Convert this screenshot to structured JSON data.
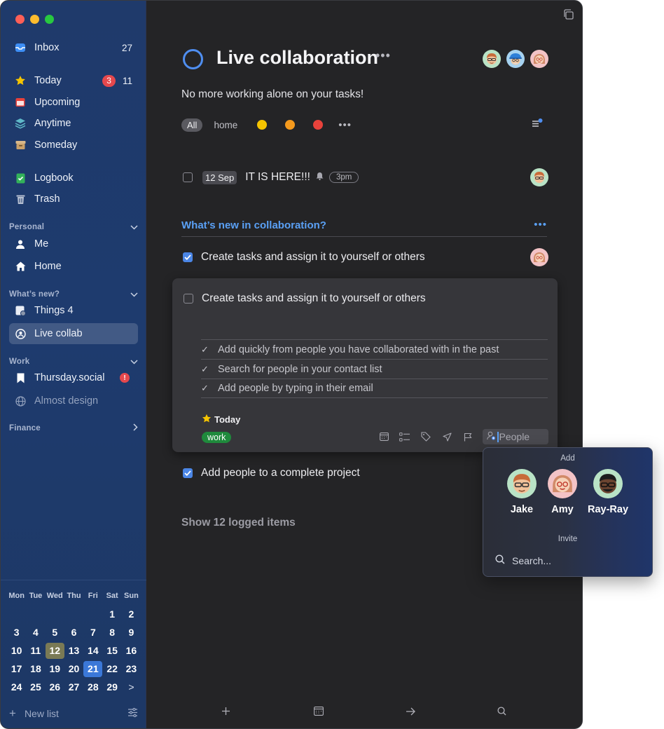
{
  "sidebar": {
    "inbox": {
      "label": "Inbox",
      "count": "27"
    },
    "today": {
      "label": "Today",
      "badge": "3",
      "count": "11"
    },
    "upcoming": {
      "label": "Upcoming"
    },
    "anytime": {
      "label": "Anytime"
    },
    "someday": {
      "label": "Someday"
    },
    "logbook": {
      "label": "Logbook"
    },
    "trash": {
      "label": "Trash"
    },
    "areas": [
      {
        "title": "Personal",
        "items": [
          "Me",
          "Home"
        ]
      },
      {
        "title": "What’s new?",
        "items": [
          "Things 4",
          "Live collab"
        ]
      },
      {
        "title": "Work",
        "items": [
          "Thursday.social",
          "Almost design"
        ]
      },
      {
        "title": "Finance",
        "items": []
      }
    ],
    "calendar": {
      "days_of_week": [
        "Mon",
        "Tue",
        "Wed",
        "Thu",
        "Fri",
        "Sat",
        "Sun"
      ],
      "rows": [
        [
          "",
          "",
          "",
          "",
          "",
          "1",
          "2"
        ],
        [
          "3",
          "4",
          "5",
          "6",
          "7",
          "8",
          "9"
        ],
        [
          "10",
          "11",
          "12",
          "13",
          "14",
          "15",
          "16"
        ],
        [
          "17",
          "18",
          "19",
          "20",
          "21",
          "22",
          "23"
        ],
        [
          "24",
          "25",
          "26",
          "27",
          "28",
          "29",
          ">"
        ]
      ],
      "today": "12",
      "selected": "21"
    },
    "footer": {
      "new_list": "New list"
    }
  },
  "project": {
    "title": "Live collaboration",
    "more": "•••",
    "notes": "No more working alone on your tasks!",
    "tag_filters": {
      "all": "All",
      "home": "home",
      "more": "•••"
    },
    "tag_colors": [
      "#f5c400",
      "#f59a1d",
      "#e8423b"
    ]
  },
  "tasks": {
    "first": {
      "date": "12 Sep",
      "title": "IT IS HERE!!!",
      "time": "3pm"
    },
    "heading": {
      "title": "What’s new in collaboration?",
      "more": "•••"
    },
    "task1": {
      "title": "Create tasks and assign it to yourself or others",
      "checked": true
    },
    "open_task": {
      "title": "Create tasks and assign it to yourself or others",
      "checklist": [
        "Add  quickly from people you have collaborated with in the past",
        "Search for people in your contact list",
        "Add people by typing in their email"
      ],
      "when": "Today",
      "tag": "work",
      "people_placeholder": "People"
    },
    "task3": {
      "title": "Add people to a complete project",
      "checked": true
    },
    "logged": "Show 12 logged items"
  },
  "popover": {
    "add_label": "Add",
    "people": [
      "Jake",
      "Amy",
      "Ray-Ray"
    ],
    "invite_label": "Invite",
    "search_placeholder": "Search..."
  },
  "colors": {
    "accent": "#4f8ef0",
    "sidebar": "#1e3b6e",
    "main_bg": "#242426",
    "work_tag": "#1f8a3c"
  }
}
